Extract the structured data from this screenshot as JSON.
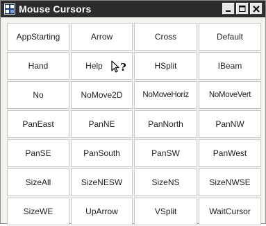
{
  "window": {
    "title": "Mouse Cursors"
  },
  "caption_buttons": {
    "minimize": "_",
    "maximize": "□",
    "close": "×"
  },
  "cursors": [
    "AppStarting",
    "Arrow",
    "Cross",
    "Default",
    "Hand",
    "Help",
    "HSplit",
    "IBeam",
    "No",
    "NoMove2D",
    "NoMoveHoriz",
    "NoMoveVert",
    "PanEast",
    "PanNE",
    "PanNorth",
    "PanNW",
    "PanSE",
    "PanSouth",
    "PanSW",
    "PanWest",
    "SizeAll",
    "SizeNESW",
    "SizeNS",
    "SizeNWSE",
    "SizeWE",
    "UpArrow",
    "VSplit",
    "WaitCursor"
  ],
  "icons": {
    "app": "app-window-icon",
    "help_cursor": "help-cursor-icon"
  },
  "colors": {
    "titlebar": "#2c2c2c",
    "background": "#f4f3ee",
    "button_face": "#ffffff",
    "button_border": "#c8c8c8"
  }
}
